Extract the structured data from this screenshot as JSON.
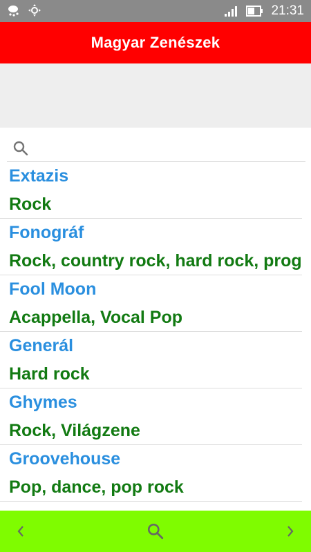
{
  "status_bar": {
    "time": "21:31",
    "icons": [
      "weather-icon",
      "navigation-icon",
      "signal-icon",
      "battery-icon"
    ]
  },
  "app_bar": {
    "title": "Magyar Zenészek",
    "color": "#ff0000"
  },
  "search": {
    "value": "",
    "placeholder": ""
  },
  "list": {
    "items": [
      {
        "name": "Extazis",
        "genre": "Rock"
      },
      {
        "name": "Fonográf",
        "genre": "Rock, country rock, hard rock, prog"
      },
      {
        "name": "Fool Moon",
        "genre": "Acappella, Vocal Pop"
      },
      {
        "name": "Generál",
        "genre": "Hard rock"
      },
      {
        "name": "Ghymes",
        "genre": "Rock, Világzene"
      },
      {
        "name": "Groovehouse",
        "genre": "Pop, dance, pop rock"
      }
    ]
  },
  "bottom_bar": {
    "color": "#7ffc00",
    "icons": [
      "chevron-left-icon",
      "search-icon",
      "chevron-right-icon"
    ]
  },
  "colors": {
    "name_text": "#2a8fdf",
    "genre_text": "#127a12",
    "status_bar": "#8a8a8a"
  }
}
